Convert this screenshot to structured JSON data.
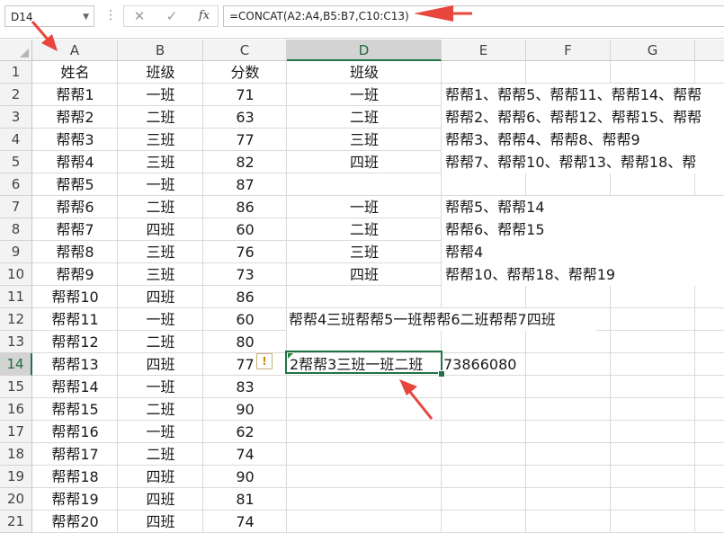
{
  "formula_bar": {
    "name_box": "D14",
    "fx_label": "fx",
    "cancel_glyph": "✕",
    "confirm_glyph": "✓",
    "formula": "=CONCAT(A2:A4,B5:B7,C10:C13)"
  },
  "columns": [
    "A",
    "B",
    "C",
    "D",
    "E",
    "F",
    "G"
  ],
  "selected_column": "D",
  "row_numbers": [
    "1",
    "2",
    "3",
    "4",
    "5",
    "6",
    "7",
    "8",
    "9",
    "10",
    "11",
    "12",
    "13",
    "14",
    "15",
    "16",
    "17",
    "18",
    "19",
    "20",
    "21"
  ],
  "selected_row": "14",
  "headers": {
    "a": "姓名",
    "b": "班级",
    "c": "分数",
    "d": "班级"
  },
  "table": [
    {
      "name": "帮帮1",
      "class": "一班",
      "score": "71"
    },
    {
      "name": "帮帮2",
      "class": "二班",
      "score": "63"
    },
    {
      "name": "帮帮3",
      "class": "三班",
      "score": "77"
    },
    {
      "name": "帮帮4",
      "class": "三班",
      "score": "82"
    },
    {
      "name": "帮帮5",
      "class": "一班",
      "score": "87"
    },
    {
      "name": "帮帮6",
      "class": "二班",
      "score": "86"
    },
    {
      "name": "帮帮7",
      "class": "四班",
      "score": "60"
    },
    {
      "name": "帮帮8",
      "class": "三班",
      "score": "76"
    },
    {
      "name": "帮帮9",
      "class": "三班",
      "score": "73"
    },
    {
      "name": "帮帮10",
      "class": "四班",
      "score": "86"
    },
    {
      "name": "帮帮11",
      "class": "一班",
      "score": "60"
    },
    {
      "name": "帮帮12",
      "class": "二班",
      "score": "80"
    },
    {
      "name": "帮帮13",
      "class": "四班",
      "score": "77"
    },
    {
      "name": "帮帮14",
      "class": "一班",
      "score": "83"
    },
    {
      "name": "帮帮15",
      "class": "二班",
      "score": "90"
    },
    {
      "name": "帮帮16",
      "class": "一班",
      "score": "62"
    },
    {
      "name": "帮帮17",
      "class": "二班",
      "score": "74"
    },
    {
      "name": "帮帮18",
      "class": "四班",
      "score": "90"
    },
    {
      "name": "帮帮19",
      "class": "四班",
      "score": "81"
    },
    {
      "name": "帮帮20",
      "class": "四班",
      "score": "74"
    }
  ],
  "groups_full": [
    {
      "class": "一班",
      "members": "帮帮1、帮帮5、帮帮11、帮帮14、帮帮"
    },
    {
      "class": "二班",
      "members": "帮帮2、帮帮6、帮帮12、帮帮15、帮帮"
    },
    {
      "class": "三班",
      "members": "帮帮3、帮帮4、帮帮8、帮帮9"
    },
    {
      "class": "四班",
      "members": "帮帮7、帮帮10、帮帮13、帮帮18、帮"
    }
  ],
  "groups_partial": [
    {
      "class": "一班",
      "members": "帮帮5、帮帮14"
    },
    {
      "class": "二班",
      "members": "帮帮6、帮帮15"
    },
    {
      "class": "三班",
      "members": "帮帮4"
    },
    {
      "class": "四班",
      "members": "帮帮10、帮帮18、帮帮19"
    }
  ],
  "row12_text": "帮帮4三班帮帮5一班帮帮6二班帮帮7四班",
  "row14_d": "2帮帮3三班一班二班",
  "row14_e": "73866080",
  "warning_glyph": "!",
  "colors": {
    "accent": "#217346",
    "arrow": "#e8453c"
  }
}
